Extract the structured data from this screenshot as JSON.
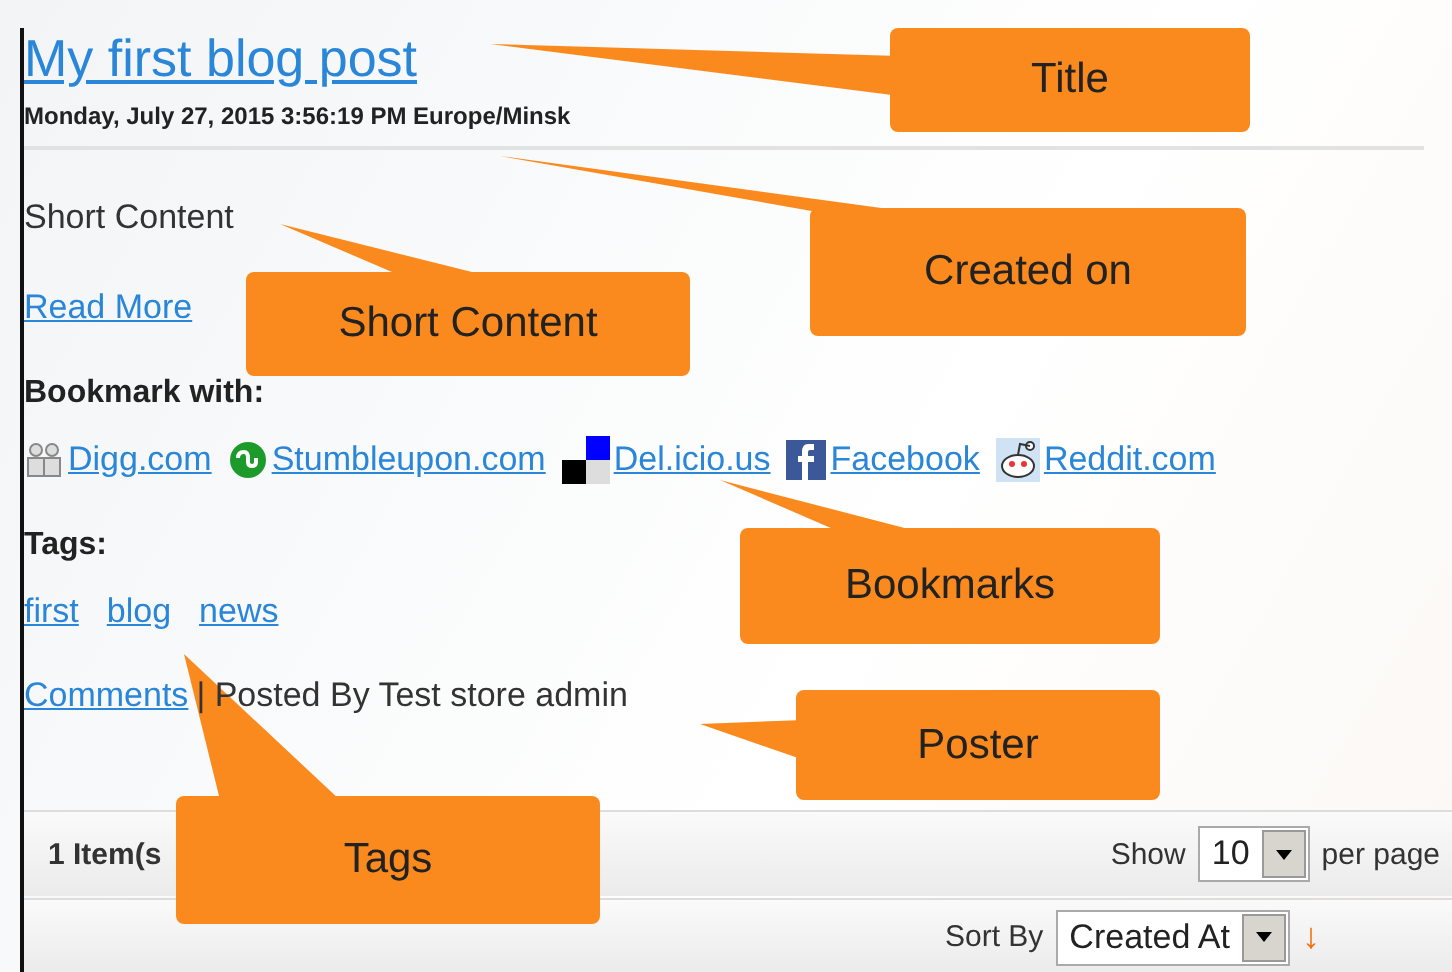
{
  "post": {
    "title": "My first blog post",
    "created_on": "Monday, July 27, 2015 3:56:19 PM Europe/Minsk",
    "short_content": "Short Content",
    "read_more": "Read More",
    "bookmark_heading": "Bookmark with:",
    "bookmarks": [
      {
        "kind": "digg",
        "label": "Digg.com"
      },
      {
        "kind": "stumbleupon",
        "label": "Stumbleupon.com"
      },
      {
        "kind": "delicious",
        "label": "Del.icio.us"
      },
      {
        "kind": "facebook",
        "label": "Facebook"
      },
      {
        "kind": "reddit",
        "label": "Reddit.com"
      }
    ],
    "tags_heading": "Tags:",
    "tags": [
      "first",
      "blog",
      "news"
    ],
    "comments_link": "Comments",
    "poster": "| Posted By Test store admin"
  },
  "toolbar": {
    "item_count": "1 Item(s",
    "show_label": "Show",
    "per_page_value": "10",
    "per_page_label": "per page",
    "sort_label": "Sort By",
    "sort_value": "Created At",
    "sort_direction": "↓"
  },
  "callouts": [
    {
      "label": "Title"
    },
    {
      "label": "Created on"
    },
    {
      "label": "Short Content"
    },
    {
      "label": "Bookmarks"
    },
    {
      "label": "Poster"
    },
    {
      "label": "Tags"
    }
  ]
}
